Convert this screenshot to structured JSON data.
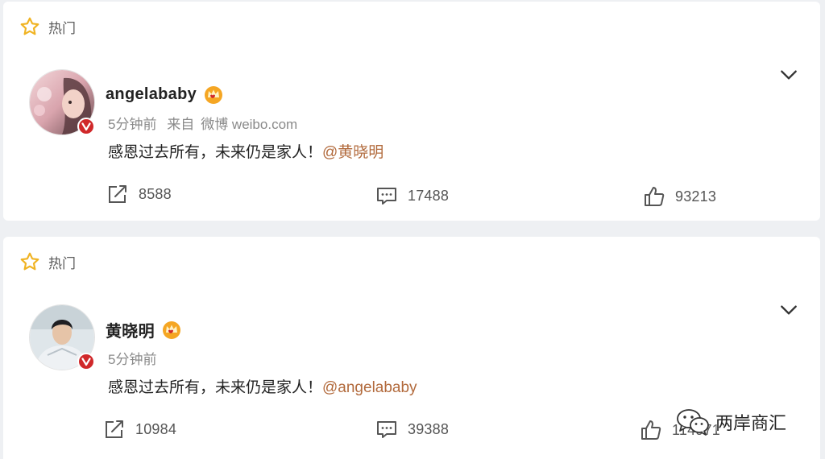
{
  "posts": [
    {
      "hot_label": "热门",
      "author": "angelababy",
      "time": "5分钟前",
      "source_prefix": "来自",
      "source": "微博 weibo.com",
      "text": "感恩过去所有，未来仍是家人！",
      "mention": "@黄晓明",
      "repost_count": "8588",
      "comment_count": "17488",
      "like_count": "93213"
    },
    {
      "hot_label": "热门",
      "author": "黄晓明",
      "time": "5分钟前",
      "text": "感恩过去所有，未来仍是家人！",
      "mention": "@angelababy",
      "repost_count": "10984",
      "comment_count": "39388",
      "like_count": "114971"
    }
  ],
  "watermark": {
    "text": "两岸商汇"
  },
  "colors": {
    "star": "#f0b322",
    "mention": "#b26a3c",
    "verified": "#d0282a",
    "crown": "#f5a623"
  },
  "icons": [
    "star-icon",
    "chevron-down-icon",
    "verified-badge-icon",
    "crown-icon",
    "repost-icon",
    "comment-icon",
    "like-icon",
    "wechat-icon"
  ]
}
